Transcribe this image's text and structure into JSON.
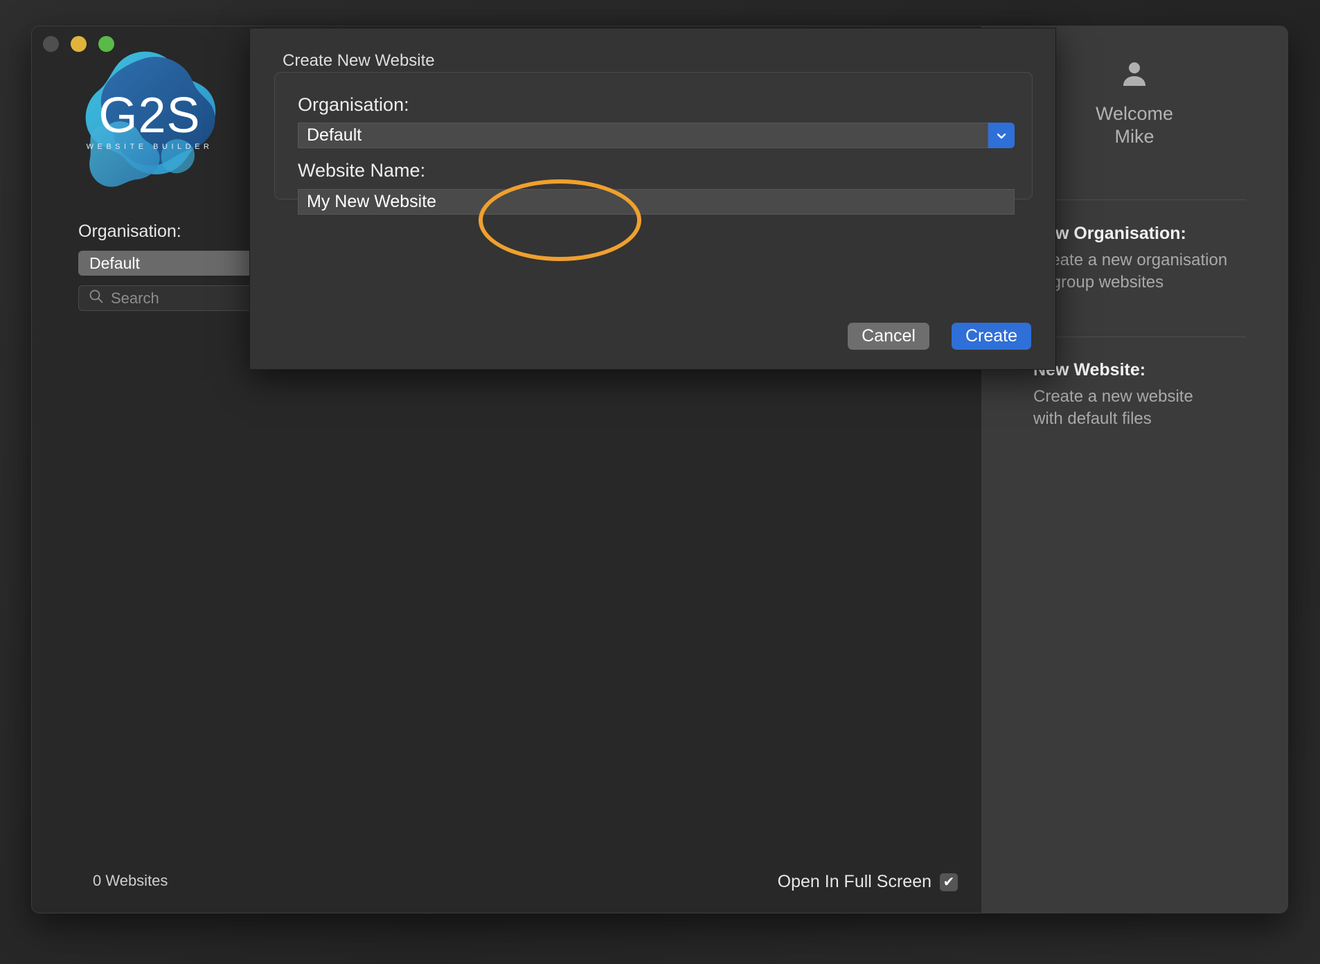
{
  "window": {
    "traffic_lights": [
      "close",
      "minimize",
      "maximize"
    ]
  },
  "logo": {
    "name": "g2s-logo",
    "wordmark": "G2S",
    "tagline": "WEBSITE BUILDER"
  },
  "sidebar_left": {
    "organisation_label": "Organisation:",
    "organisation_value": "Default",
    "search_placeholder": "Search",
    "search_icon": "search-icon"
  },
  "statusbar": {
    "websites_count": "0 Websites",
    "fullscreen_label": "Open In Full Screen",
    "fullscreen_checked": true,
    "check_glyph": "✔"
  },
  "sidebar_right": {
    "avatar_icon": "person-icon",
    "welcome_line1": "Welcome",
    "welcome_line2": "Mike",
    "sections": [
      {
        "heading": "New Organisation:",
        "body_line1": "Create a new organisation",
        "body_line2": "to group websites"
      },
      {
        "heading": "New Website:",
        "body_line1": "Create a new website",
        "body_line2": "with default files"
      }
    ]
  },
  "dialog": {
    "title": "Create New Website",
    "organisation_label": "Organisation:",
    "organisation_value": "Default",
    "organisation_dropdown_icon": "chevron-down-icon",
    "website_name_label": "Website Name:",
    "website_name_value": "My New Website",
    "cancel_label": "Cancel",
    "create_label": "Create"
  },
  "annotation": {
    "shape": "ellipse",
    "color": "#f0a02e",
    "target": "website-name-field"
  },
  "colors": {
    "accent_blue": "#2f6fd8",
    "annotation_orange": "#f0a02e",
    "window_bg": "#282828",
    "sidepane_bg": "#3b3b3b",
    "dialog_bg": "#343434"
  }
}
